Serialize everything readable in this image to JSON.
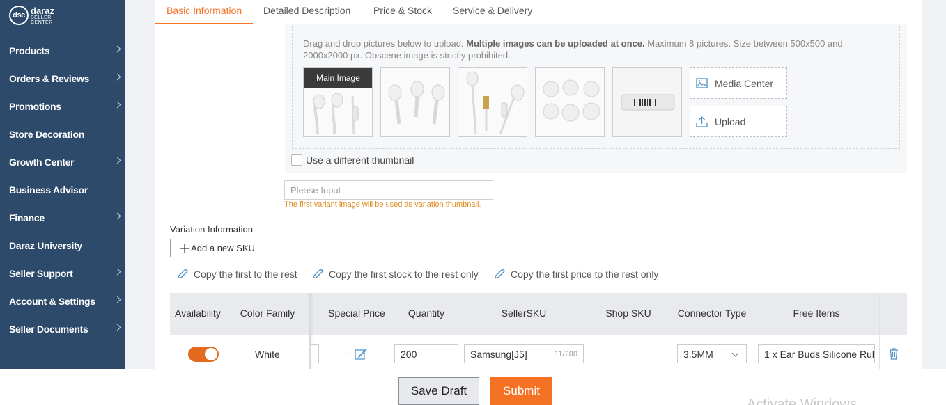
{
  "sidebar": {
    "logo_mark": "dsc",
    "logo_brand": "daraz",
    "logo_sub_1": "SELLER",
    "logo_sub_2": "CENTER",
    "items": [
      {
        "label": "Products",
        "has_chevron": true
      },
      {
        "label": "Orders & Reviews",
        "has_chevron": true
      },
      {
        "label": "Promotions",
        "has_chevron": true
      },
      {
        "label": "Store Decoration",
        "has_chevron": false
      },
      {
        "label": "Growth Center",
        "has_chevron": true
      },
      {
        "label": "Business Advisor",
        "has_chevron": false
      },
      {
        "label": "Finance",
        "has_chevron": true
      },
      {
        "label": "Daraz University",
        "has_chevron": false
      },
      {
        "label": "Seller Support",
        "has_chevron": true
      },
      {
        "label": "Account & Settings",
        "has_chevron": true
      },
      {
        "label": "Seller Documents",
        "has_chevron": true
      }
    ]
  },
  "tabs": [
    {
      "label": "Basic Information",
      "active": true
    },
    {
      "label": "Detailed Description",
      "active": false
    },
    {
      "label": "Price & Stock",
      "active": false
    },
    {
      "label": "Service & Delivery",
      "active": false
    }
  ],
  "upload": {
    "hint_start": "Drag and drop pictures below to upload. ",
    "hint_bold": "Multiple images can be uploaded at once.",
    "hint_end": " Maximum 8 pictures. Size between 500x500 and 2000x2000 px. Obscene image is strictly prohibited.",
    "main_image_label": "Main Image",
    "media_center_label": "Media Center",
    "upload_label": "Upload",
    "thumbnail_checkbox_label": "Use a different thumbnail"
  },
  "variant_image_input": {
    "placeholder": "Please Input",
    "note": "The first variant image will be used as variation thumbnail."
  },
  "variation": {
    "title": "Variation Information",
    "add_sku_label": "Add a new SKU",
    "copy_all": "Copy the first to the rest",
    "copy_stock": "Copy the first stock to the rest only",
    "copy_price": "Copy the first price to the rest only"
  },
  "table": {
    "headers": {
      "availability": "Availability",
      "color_family": "Color Family",
      "special_price": "Special Price",
      "quantity": "Quantity",
      "seller_sku": "SellerSKU",
      "shop_sku": "Shop SKU",
      "connector_type": "Connector Type",
      "free_items": "Free Items"
    },
    "row": {
      "availability_on": true,
      "color_family": "White",
      "special_price": "-",
      "quantity": "200",
      "seller_sku": "Samsung[J5]",
      "seller_sku_counter": "11/200",
      "connector_type": "3.5MM",
      "free_items": "1 x Ear Buds Silicone Rub"
    }
  },
  "footer": {
    "save_draft": "Save Draft",
    "submit": "Submit",
    "watermark": "Activate Windows"
  },
  "colors": {
    "sidebar_bg": "#2d4a6b",
    "accent": "#f57224",
    "note": "#e28a1d",
    "link_icon": "#4a90c8"
  }
}
